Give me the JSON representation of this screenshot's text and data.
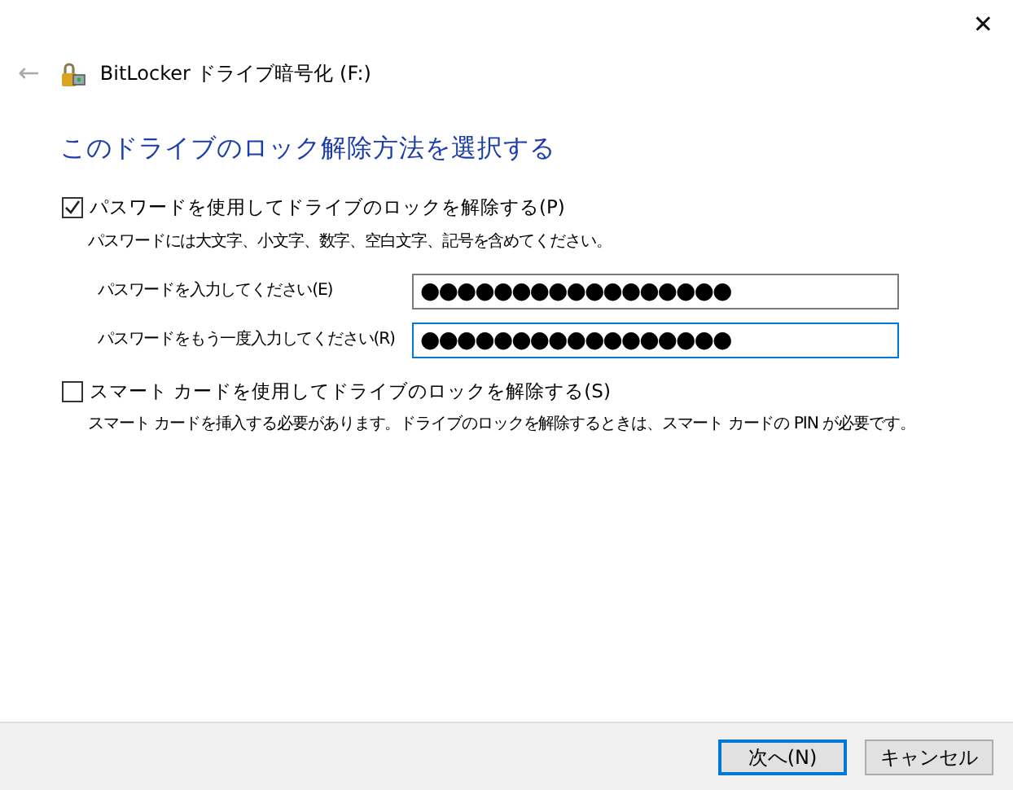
{
  "window": {
    "close": "✕"
  },
  "header": {
    "back": "←",
    "title": "BitLocker ドライブ暗号化 (F:)"
  },
  "heading": "このドライブのロック解除方法を選択する",
  "options": [
    {
      "label": "パスワードを使用してドライブのロックを解除する(P)",
      "checked": true,
      "description": "パスワードには大文字、小文字、数字、空白文字、記号を含めてください。",
      "fields": [
        {
          "label": "パスワードを入力してください(E)",
          "value": "●●●●●●●●●●●●●●●●●",
          "focused": false
        },
        {
          "label": "パスワードをもう一度入力してください(R)",
          "value": "●●●●●●●●●●●●●●●●●",
          "focused": true
        }
      ]
    },
    {
      "label": "スマート カードを使用してドライブのロックを解除する(S)",
      "checked": false,
      "description": "スマート カードを挿入する必要があります。ドライブのロックを解除するときは、スマート カードの PIN が必要です。"
    }
  ],
  "buttons": [
    {
      "label": "次へ(N)",
      "default": true
    },
    {
      "label": "キャンセル",
      "default": false
    }
  ]
}
